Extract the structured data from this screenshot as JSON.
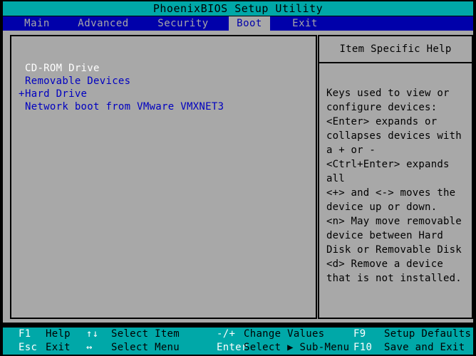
{
  "window": {
    "title": "PhoenixBIOS Setup Utility"
  },
  "colors": {
    "title_bg": "#00a8a8",
    "menu_bg": "#0000aa",
    "body_bg": "#a8a8a8",
    "accent_blue": "#0000c0",
    "selected_text": "#ffffff",
    "keybar_bg": "#00a8a8"
  },
  "menu": {
    "tabs": [
      {
        "label": "Main",
        "active": false
      },
      {
        "label": "Advanced",
        "active": false
      },
      {
        "label": "Security",
        "active": false
      },
      {
        "label": "Boot",
        "active": true
      },
      {
        "label": "Exit",
        "active": false
      }
    ]
  },
  "boot_list": {
    "items": [
      {
        "prefix": " ",
        "label": "CD-ROM Drive",
        "selected": true
      },
      {
        "prefix": " ",
        "label": "Removable Devices",
        "selected": false
      },
      {
        "prefix": "+",
        "label": "Hard Drive",
        "selected": false
      },
      {
        "prefix": " ",
        "label": "Network boot from VMware VMXNET3",
        "selected": false
      }
    ]
  },
  "help": {
    "header": "Item Specific Help",
    "lines": [
      "Keys used to view or",
      "configure devices:",
      "<Enter> expands or",
      "collapses devices with",
      "a + or -",
      "<Ctrl+Enter> expands",
      "all",
      "<+> and <-> moves the",
      "device up or down.",
      "<n> May move removable",
      "device between Hard",
      "Disk or Removable Disk",
      "<d> Remove a device",
      "that is not installed."
    ]
  },
  "key_bar": {
    "row1": [
      {
        "key": "F1",
        "desc": "Help"
      },
      {
        "key": "↑↓",
        "desc": "Select Item"
      },
      {
        "key": "-/+",
        "desc": "Change Values"
      },
      {
        "key": "F9",
        "desc": "Setup Defaults"
      }
    ],
    "row2": [
      {
        "key": "Esc",
        "desc": "Exit"
      },
      {
        "key": "↔",
        "desc": "Select Menu"
      },
      {
        "key": "Enter",
        "desc": "Select ▶ Sub-Menu"
      },
      {
        "key": "F10",
        "desc": "Save and Exit"
      }
    ]
  }
}
